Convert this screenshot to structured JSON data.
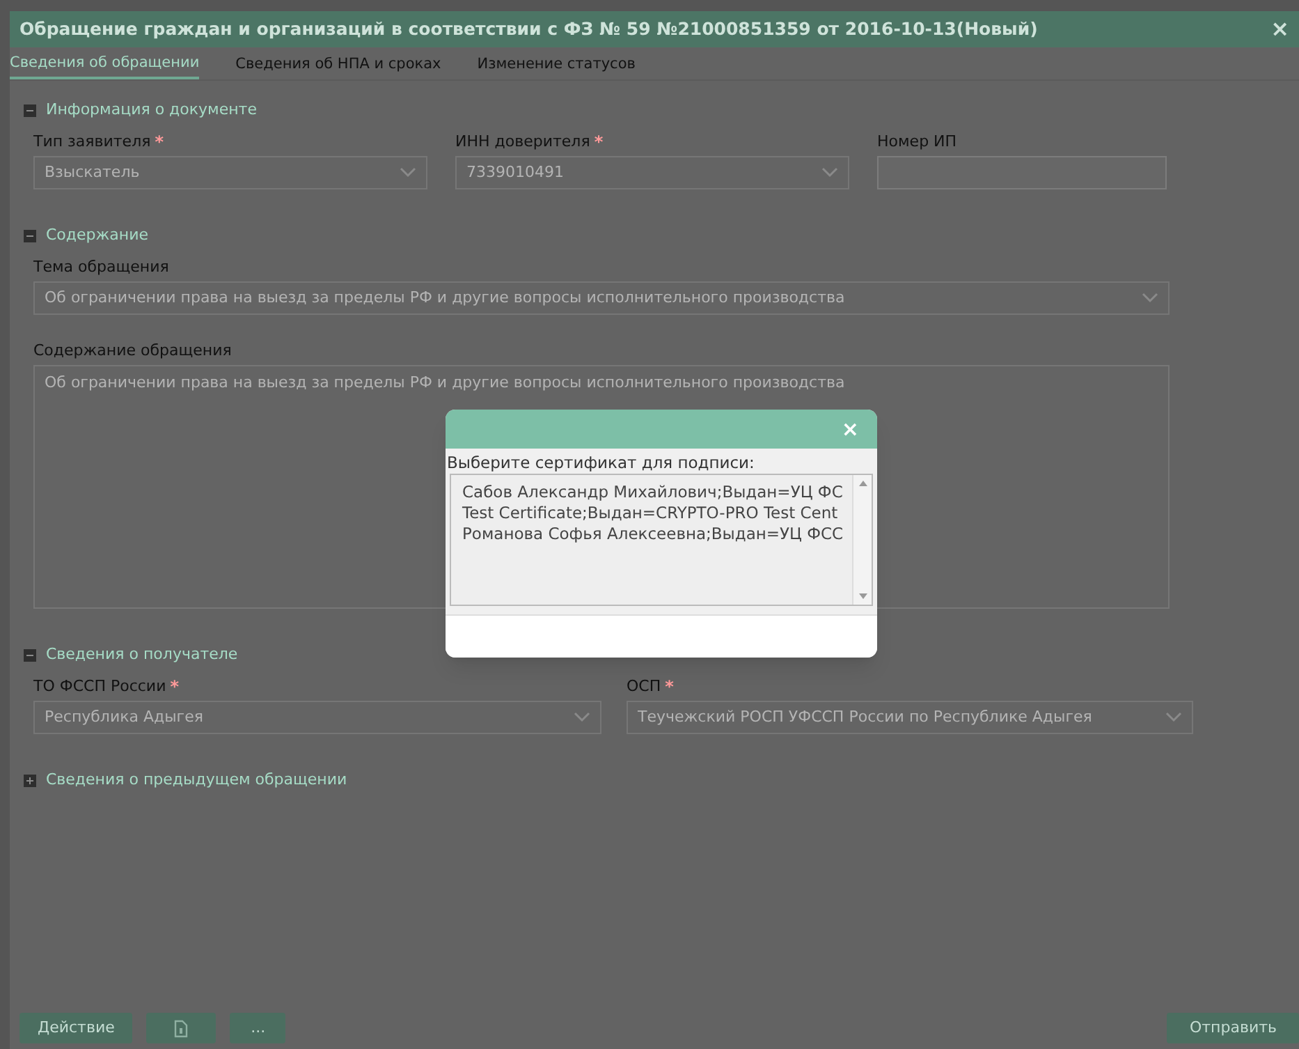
{
  "window": {
    "title": "Обращение граждан и организаций в соответствии с ФЗ № 59 №21000851359 от 2016-10-13(Новый)",
    "close": "×"
  },
  "tabs": [
    {
      "label": "Сведения об обращении",
      "selected": true
    },
    {
      "label": "Сведения об НПА и сроках",
      "selected": false
    },
    {
      "label": "Изменение статусов",
      "selected": false
    }
  ],
  "sections": [
    {
      "title": "Информация о документе",
      "expanded": true,
      "fields": [
        {
          "kind": "select",
          "label": "Тип заявителя",
          "required_mark": "*",
          "value": "Взыскатель"
        },
        {
          "kind": "select",
          "label": "ИНН доверителя",
          "required_mark": "*",
          "value": "7339010491"
        },
        {
          "kind": "text",
          "label": "Номер ИП"
        }
      ]
    },
    {
      "title": "Содержание",
      "expanded": true,
      "fields": [
        {
          "kind": "select",
          "label": "Тема обращения",
          "value": "Об ограничении права на выезд за пределы РФ и другие вопросы исполнительного производства"
        },
        {
          "kind": "textarea",
          "label": "Содержание обращения",
          "value": "Об ограничении права на выезд за пределы РФ и другие вопросы исполнительного производства"
        }
      ]
    },
    {
      "title": "Сведения о получателе",
      "expanded": true,
      "fields": [
        {
          "kind": "select",
          "label": "ТО ФССП России",
          "required_mark": "*",
          "value": "Республика Адыгея"
        },
        {
          "kind": "select",
          "label": "ОСП",
          "required_mark": "*",
          "value": "Теучежский РОСП УФССП России по Республике Адыгея"
        }
      ]
    },
    {
      "title": "Сведения о предыдущем обращении",
      "expanded": false
    }
  ],
  "footer": {
    "action_button": "Действие",
    "more_button": "...",
    "send_button": "Отправить"
  },
  "dialog": {
    "close": "×",
    "prompt": "Выберите сертификат для подписи:",
    "certificates": [
      "Сабов Александр Михайлович;Выдан=УЦ ФС",
      "Test Certificate;Выдан=CRYPTO-PRO Test Cent",
      "Романова Софья Алексеевна;Выдан=УЦ ФСС"
    ]
  }
}
